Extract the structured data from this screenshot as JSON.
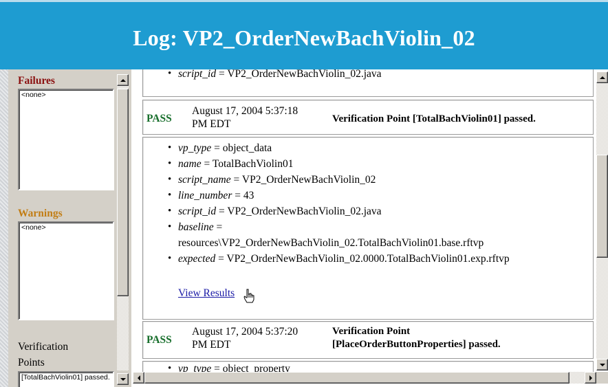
{
  "window": {
    "title": "Log: VP2_OrderNewBachViolin_02",
    "accent": "#1e9cd1"
  },
  "sidebar": {
    "failures": {
      "heading": "Failures",
      "color": "#8b1010",
      "items": [
        "<none>"
      ]
    },
    "warnings": {
      "heading": "Warnings",
      "color": "#c27d14",
      "items": [
        "<none>"
      ]
    },
    "verification_points": {
      "heading_line1": "Verification",
      "heading_line2": "Points",
      "items": [
        "[TotalBachViolin01] passed."
      ]
    }
  },
  "log": {
    "entry0": {
      "props": [
        {
          "key": "script_id",
          "value": "VP2_OrderNewBachViolin_02.java"
        }
      ]
    },
    "entry1": {
      "status": "PASS",
      "time_line1": "August 17, 2004 5:37:18",
      "time_line2": "PM EDT",
      "message": "Verification Point [TotalBachViolin01] passed.",
      "props": [
        {
          "key": "vp_type",
          "value": "object_data"
        },
        {
          "key": "name",
          "value": "TotalBachViolin01"
        },
        {
          "key": "script_name",
          "value": "VP2_OrderNewBachViolin_02"
        },
        {
          "key": "line_number",
          "value": "43"
        },
        {
          "key": "script_id",
          "value": "VP2_OrderNewBachViolin_02.java"
        },
        {
          "key": "baseline",
          "value": "",
          "value_line2": "resources\\VP2_OrderNewBachViolin_02.TotalBachViolin01.base.rftvp"
        },
        {
          "key": "expected",
          "value": "VP2_OrderNewBachViolin_02.0000.TotalBachViolin01.exp.rftvp"
        }
      ],
      "link": "View Results"
    },
    "entry2": {
      "status": "PASS",
      "time_line1": "August 17, 2004 5:37:20",
      "time_line2": "PM EDT",
      "message_line1": "Verification Point",
      "message_line2": "[PlaceOrderButtonProperties] passed.",
      "props": [
        {
          "key": "vp_type",
          "value": "object_property"
        }
      ]
    }
  },
  "symbols": {
    "equals": "="
  }
}
